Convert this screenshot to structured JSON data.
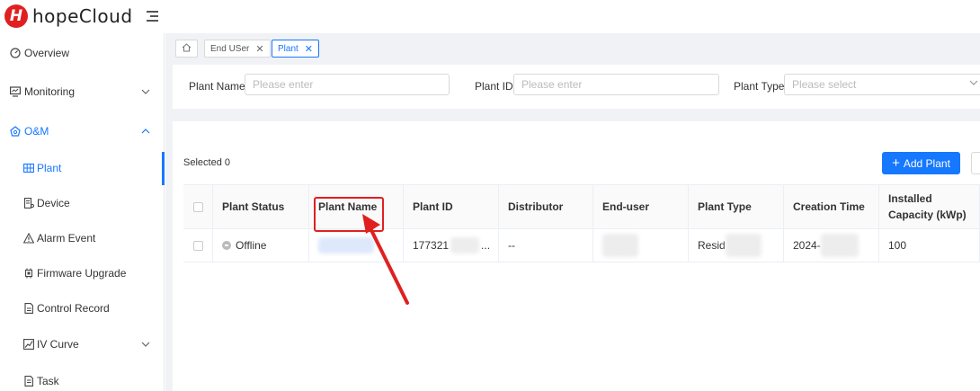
{
  "app": {
    "name": "hopeCloud",
    "logo_letter": "H"
  },
  "sidebar": {
    "items": [
      {
        "label": "Overview",
        "icon": "dashboard-icon"
      },
      {
        "label": "Monitoring",
        "icon": "monitor-icon",
        "expandable": true
      },
      {
        "label": "O&M",
        "icon": "maintenance-icon",
        "expandable": true,
        "expanded": true
      },
      {
        "label": "Plant",
        "icon": "grid-icon",
        "active": true
      },
      {
        "label": "Device",
        "icon": "device-icon"
      },
      {
        "label": "Alarm Event",
        "icon": "warning-icon"
      },
      {
        "label": "Firmware Upgrade",
        "icon": "chip-icon"
      },
      {
        "label": "Control Record",
        "icon": "document-icon"
      },
      {
        "label": "IV Curve",
        "icon": "curve-icon",
        "expandable": true
      },
      {
        "label": "Task",
        "icon": "task-icon"
      }
    ]
  },
  "tabs": [
    {
      "label": "End USer",
      "closable": true
    },
    {
      "label": "Plant",
      "closable": true,
      "current": true
    }
  ],
  "filters": {
    "plant_name": {
      "label": "Plant Name",
      "placeholder": "Please enter"
    },
    "plant_id": {
      "label": "Plant ID",
      "placeholder": "Please enter"
    },
    "plant_type": {
      "label": "Plant Type",
      "placeholder": "Please select"
    }
  },
  "toolbar": {
    "selected": "Selected 0",
    "add_plant": "Add Plant"
  },
  "table": {
    "columns": [
      "Plant Status",
      "Plant Name",
      "Plant ID",
      "Distributor",
      "End-user",
      "Plant Type",
      "Creation Time",
      "Installed Capacity (kWp)"
    ],
    "rows": [
      {
        "status": "Offline",
        "plant_id_visible": "177321",
        "plant_id_suffix": "...",
        "distributor": "--",
        "plant_type_visible": "Resid",
        "creation_time_visible": "2024-",
        "installed_capacity": "100"
      }
    ]
  },
  "colors": {
    "accent": "#1677ff",
    "brand_red": "#e02020",
    "annotation": "#e02020"
  }
}
